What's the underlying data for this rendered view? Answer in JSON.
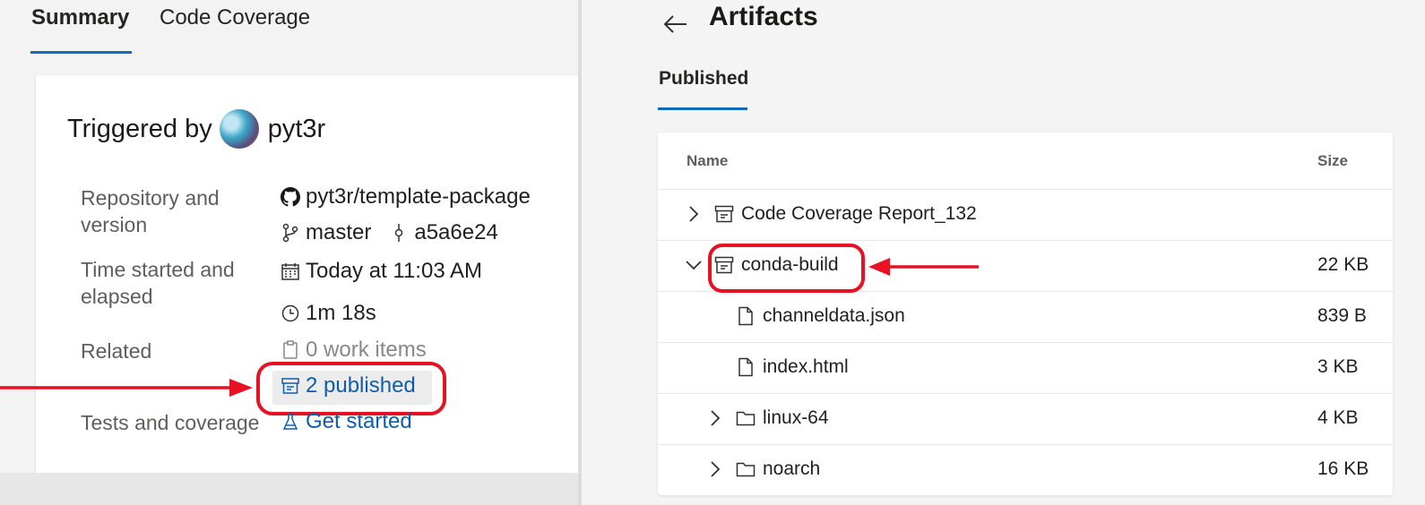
{
  "summary": {
    "tabs": [
      {
        "label": "Summary",
        "active": true
      },
      {
        "label": "Code Coverage",
        "active": false
      }
    ],
    "triggered_prefix": "Triggered by",
    "triggered_user": "pyt3r",
    "repository_label": "Repository and version",
    "repository_name": "pyt3r/template-package",
    "branch": "master",
    "commit": "a5a6e24",
    "time_label": "Time started and elapsed",
    "started": "Today at 11:03 AM",
    "elapsed": "1m 18s",
    "related_label": "Related",
    "work_items": "0 work items",
    "published": "2 published",
    "tests_label": "Tests and coverage",
    "tests_link": "Get started"
  },
  "artifacts": {
    "title": "Artifacts",
    "tab": "Published",
    "columns": {
      "name": "Name",
      "size": "Size"
    },
    "rows": [
      {
        "name": "Code Coverage Report_132",
        "size": "",
        "type": "artifact",
        "expanded": false
      },
      {
        "name": "conda-build",
        "size": "22 KB",
        "type": "artifact",
        "expanded": true
      },
      {
        "name": "channeldata.json",
        "size": "839 B",
        "type": "file"
      },
      {
        "name": "index.html",
        "size": "3 KB",
        "type": "file"
      },
      {
        "name": "linux-64",
        "size": "4 KB",
        "type": "folder",
        "expanded": false
      },
      {
        "name": "noarch",
        "size": "16 KB",
        "type": "folder",
        "expanded": false
      }
    ]
  },
  "colors": {
    "accent": "#0f6cbd",
    "link": "#0f5dad",
    "annotation": "#e81123"
  },
  "icons": [
    "github-icon",
    "branch-icon",
    "commit-icon",
    "calendar-icon",
    "clock-icon",
    "clipboard-icon",
    "artifact-icon",
    "flask-icon",
    "back-arrow-icon",
    "chevron-right-icon",
    "chevron-down-icon",
    "file-icon",
    "folder-icon"
  ]
}
